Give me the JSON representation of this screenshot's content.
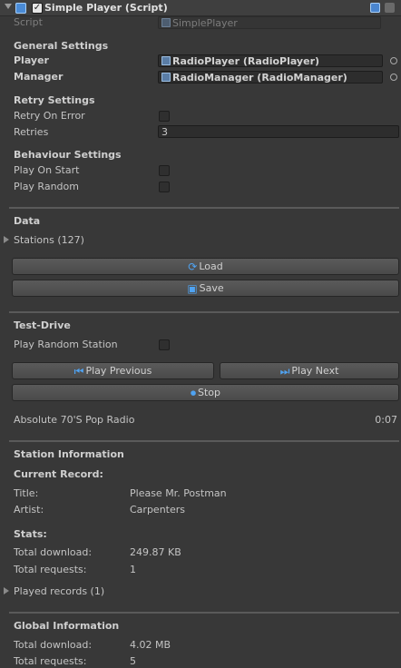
{
  "header": {
    "title": "Simple Player (Script)"
  },
  "script_row": {
    "label": "Script",
    "value": "SimplePlayer"
  },
  "general": {
    "title": "General Settings",
    "player_label": "Player",
    "player_value": "RadioPlayer (RadioPlayer)",
    "manager_label": "Manager",
    "manager_value": "RadioManager (RadioManager)"
  },
  "retry": {
    "title": "Retry Settings",
    "retry_on_error_label": "Retry On Error",
    "retries_label": "Retries",
    "retries_value": "3"
  },
  "behaviour": {
    "title": "Behaviour Settings",
    "play_on_start_label": "Play On Start",
    "play_random_label": "Play Random"
  },
  "data_section": {
    "title": "Data",
    "stations_label": "Stations (127)",
    "load_label": "Load",
    "save_label": "Save"
  },
  "test_drive": {
    "title": "Test-Drive",
    "play_random_station_label": "Play Random Station",
    "play_previous_label": "Play Previous",
    "play_next_label": "Play Next",
    "stop_label": "Stop",
    "station_name": "Absolute 70'S Pop Radio",
    "time": "0:07"
  },
  "station_info": {
    "title": "Station Information",
    "current_record_title": "Current Record:",
    "title_label": "Title:",
    "title_value": "Please Mr. Postman",
    "artist_label": "Artist:",
    "artist_value": "Carpenters",
    "stats_title": "Stats:",
    "total_download_label": "Total download:",
    "total_download_value": "249.87 KB",
    "total_requests_label": "Total requests:",
    "total_requests_value": "1",
    "played_records_label": "Played records (1)"
  },
  "global_info": {
    "title": "Global Information",
    "total_download_label": "Total download:",
    "total_download_value": "4.02 MB",
    "total_requests_label": "Total requests:",
    "total_requests_value": "5"
  }
}
